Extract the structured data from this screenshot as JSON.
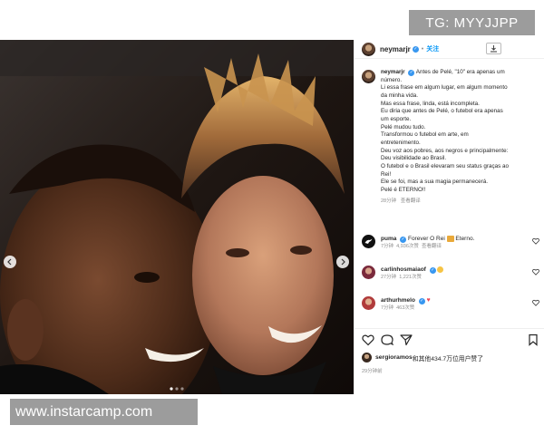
{
  "watermarks": {
    "tg": "TG: MYYJJPP",
    "site": "www.instarcamp.com"
  },
  "post": {
    "username": "neymarjr",
    "follow_label": "关注",
    "caption": {
      "username": "neymarjr",
      "lines": [
        "Antes de Pelé, \"10\" era apenas um",
        "número.",
        "Li essa frase em algum lugar, em algum momento",
        "da minha vida.",
        "Mas essa frase, linda, está incompleta.",
        "Eu diria que antes de Pelé, o futebol era apenas",
        "um esporte.",
        "Pelé mudou tudo.",
        "Transformou o futebol em arte, em",
        "entretenimento.",
        "Deu voz aos pobres, aos negros e principalmente:",
        "Deu visibilidade ao Brasil.",
        "O futebol e o Brasil elevaram seu status graças ao",
        "Rei!",
        "Ele se foi, mas a sua magia permanecerá.",
        "Pelé é ETERNO!!"
      ],
      "time": "28分钟",
      "translate": "查看翻译"
    },
    "comments": [
      {
        "username": "puma",
        "text": "Forever O Rei",
        "text2": "Eterno.",
        "time": "7分钟",
        "likes": "4,936次赞",
        "translate": "查看翻译",
        "avatar_color": "#111111"
      },
      {
        "username": "carlinhosmaiaof",
        "text": "",
        "time": "27分钟",
        "likes": "1,221次赞",
        "translate": "",
        "avatar_color": "#7a2a3c"
      },
      {
        "username": "arthurhmelo",
        "text": "",
        "time": "7分钟",
        "likes": "463次赞",
        "translate": "",
        "avatar_color": "#b03b3b"
      }
    ],
    "likes": {
      "user": "sergioramos",
      "text": "和其他434.7万位用户赞了"
    },
    "date": "29分钟前",
    "colors": {
      "accent": "#0095f6",
      "verified": "#3897f0",
      "heart": "#ed4956"
    }
  }
}
